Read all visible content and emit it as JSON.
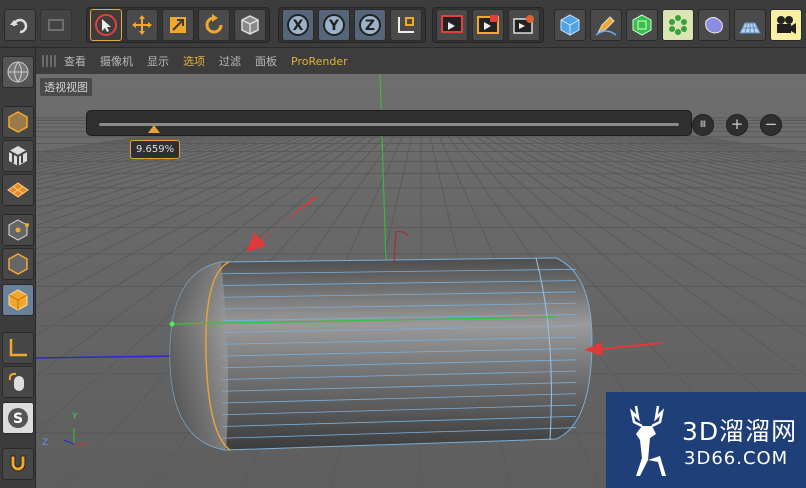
{
  "toolbar": {
    "buttons": [
      "undo-icon",
      "redo-icon",
      "select-icon",
      "move-icon",
      "scale-icon",
      "rotate-icon",
      "object-icon",
      "x-axis-icon",
      "y-axis-icon",
      "z-axis-icon",
      "coordinate-icon",
      "render-region-icon",
      "render-view-icon",
      "render-settings-icon",
      "cube-icon",
      "pen-icon",
      "subdivision-icon",
      "array-icon",
      "deformer-icon",
      "floor-icon",
      "camera-icon"
    ],
    "axis_labels": {
      "x": "X",
      "y": "Y",
      "z": "Z"
    }
  },
  "menubar": {
    "items": [
      "查看",
      "摄像机",
      "显示",
      "选项",
      "过滤",
      "面板",
      "ProRender"
    ],
    "active_index": 3
  },
  "viewport": {
    "title": "透视视图",
    "slider_value": "9.659%",
    "slider_fraction": 0.09659,
    "hud_buttons": [
      "Ⅲ",
      "+",
      "−"
    ],
    "axis_y": "Y",
    "axis_z": "Z"
  },
  "watermark": {
    "title": "3D溜溜网",
    "url": "3D66.COM"
  },
  "colors": {
    "accent": "#e0b23e",
    "selection_edge": "#e8a23a",
    "mesh_wire": "#7aaed8",
    "arrow": "#e0393a",
    "axis_green": "#36c236",
    "axis_blue": "#2a2ad0",
    "watermark_bg": "#1f3f78"
  }
}
